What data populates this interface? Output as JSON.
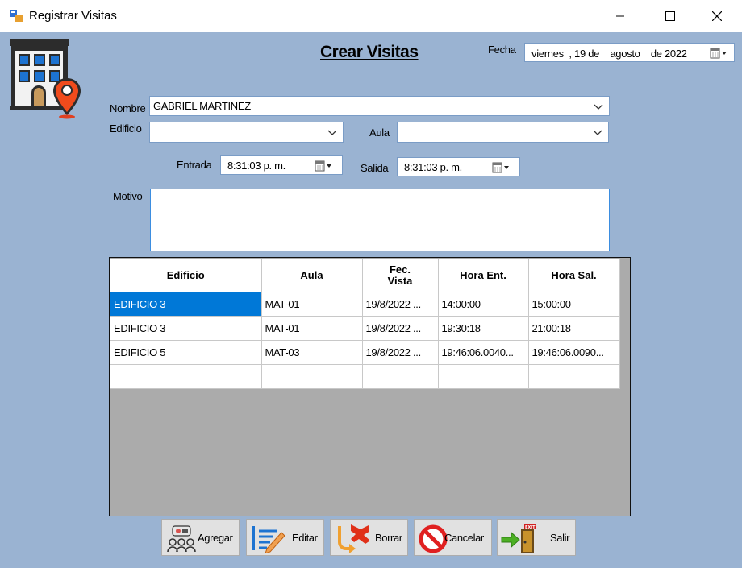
{
  "window": {
    "title": "Registrar Visitas"
  },
  "header": {
    "title": "Crear Visitas"
  },
  "form": {
    "fecha_label": "Fecha",
    "fecha_value": "viernes  , 19 de    agosto    de 2022",
    "nombre_label": "Nombre",
    "nombre_value": "GABRIEL MARTINEZ",
    "edificio_label": "Edificio",
    "edificio_value": "",
    "aula_label": "Aula",
    "aula_value": "",
    "entrada_label": "Entrada",
    "entrada_value": "8:31:03 p. m.",
    "salida_label": "Salida",
    "salida_value": "8:31:03 p. m.",
    "motivo_label": "Motivo",
    "motivo_value": ""
  },
  "table": {
    "headers": [
      "Edificio",
      "Aula",
      "Fec. Vista",
      "Hora Ent.",
      "Hora Sal."
    ],
    "rows": [
      [
        "EDIFICIO 3",
        "MAT-01",
        "19/8/2022 ...",
        "14:00:00",
        "15:00:00"
      ],
      [
        "EDIFICIO 3",
        "MAT-01",
        "19/8/2022 ...",
        "19:30:18",
        "21:00:18"
      ],
      [
        "EDIFICIO 5",
        "MAT-03",
        "19/8/2022 ...",
        "19:46:06.0040...",
        "19:46:06.0090..."
      ],
      [
        "",
        "",
        "",
        "",
        ""
      ]
    ]
  },
  "buttons": {
    "agregar": "Agregar",
    "editar": "Editar",
    "borrar": "Borrar",
    "cancelar": "Cancelar",
    "salir": "Salir"
  },
  "colors": {
    "background": "#9ab3d2",
    "selection": "#0078d7",
    "grid_background": "#ababab"
  }
}
